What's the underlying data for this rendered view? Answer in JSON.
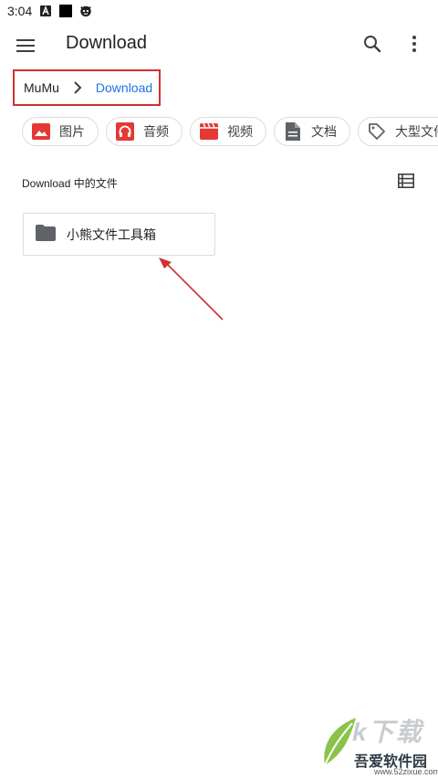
{
  "status_bar": {
    "time": "3:04",
    "icons": [
      "a-icon",
      "black-square-icon",
      "face-icon"
    ]
  },
  "app_bar": {
    "title": "Download",
    "icons": [
      "menu-icon",
      "search-icon",
      "more-vert-icon"
    ]
  },
  "breadcrumb": {
    "root": "MuMu",
    "current": "Download"
  },
  "chips": [
    {
      "label": "图片",
      "icon": "image-icon",
      "color": "#e53935"
    },
    {
      "label": "音频",
      "icon": "headphones-icon",
      "color": "#e53935"
    },
    {
      "label": "视频",
      "icon": "video-icon",
      "color": "#e53935"
    },
    {
      "label": "文档",
      "icon": "document-icon",
      "color": "#5f6368"
    },
    {
      "label": "大型文件",
      "icon": "tag-icon",
      "color": "#5f6368"
    }
  ],
  "section": {
    "title": "Download 中的文件"
  },
  "folders": [
    {
      "name": "小熊文件工具箱"
    }
  ],
  "watermark": {
    "brand": "吾爱软件园",
    "url": "www.52zixue.com",
    "big": "k下载"
  },
  "colors": {
    "accent": "#1a73e8",
    "highlight": "#d32f2f"
  }
}
